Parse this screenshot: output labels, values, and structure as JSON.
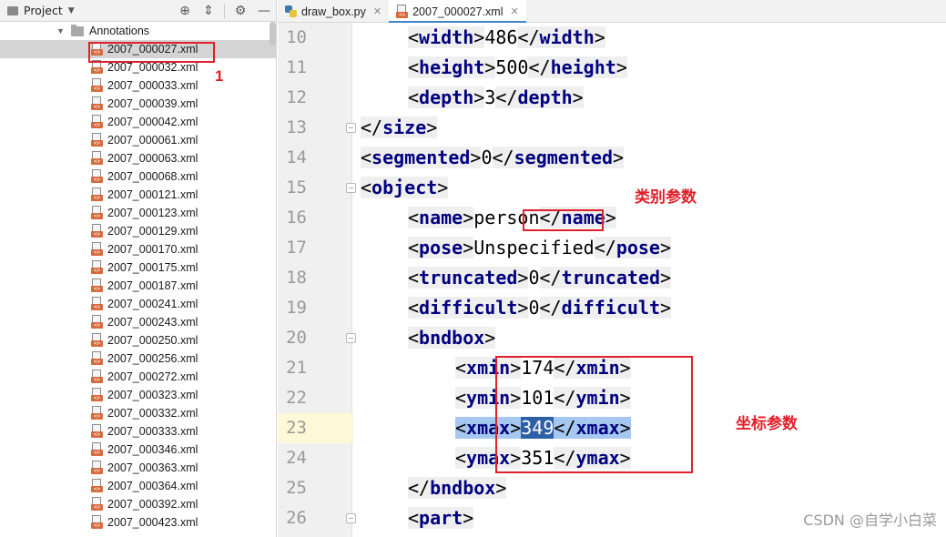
{
  "project_panel": {
    "title": "Project",
    "folder": "Annotations",
    "files": [
      "2007_000027.xml",
      "2007_000032.xml",
      "2007_000033.xml",
      "2007_000039.xml",
      "2007_000042.xml",
      "2007_000061.xml",
      "2007_000063.xml",
      "2007_000068.xml",
      "2007_000121.xml",
      "2007_000123.xml",
      "2007_000129.xml",
      "2007_000170.xml",
      "2007_000175.xml",
      "2007_000187.xml",
      "2007_000241.xml",
      "2007_000243.xml",
      "2007_000250.xml",
      "2007_000256.xml",
      "2007_000272.xml",
      "2007_000323.xml",
      "2007_000332.xml",
      "2007_000333.xml",
      "2007_000346.xml",
      "2007_000363.xml",
      "2007_000364.xml",
      "2007_000392.xml",
      "2007_000423.xml"
    ],
    "selected_index": 0,
    "annotation_number": "1"
  },
  "tabs": [
    {
      "label": "draw_box.py",
      "active": false
    },
    {
      "label": "2007_000027.xml",
      "active": true
    }
  ],
  "code": {
    "lines": [
      {
        "n": "10",
        "indent": 2,
        "parts": [
          [
            "b",
            "<"
          ],
          [
            "t",
            "width"
          ],
          [
            "b",
            ">"
          ],
          [
            "x",
            "486"
          ],
          [
            "b",
            "</"
          ],
          [
            "t",
            "width"
          ],
          [
            "b",
            ">"
          ]
        ]
      },
      {
        "n": "11",
        "indent": 2,
        "parts": [
          [
            "b",
            "<"
          ],
          [
            "t",
            "height"
          ],
          [
            "b",
            ">"
          ],
          [
            "x",
            "500"
          ],
          [
            "b",
            "</"
          ],
          [
            "t",
            "height"
          ],
          [
            "b",
            ">"
          ]
        ]
      },
      {
        "n": "12",
        "indent": 2,
        "parts": [
          [
            "b",
            "<"
          ],
          [
            "t",
            "depth"
          ],
          [
            "b",
            ">"
          ],
          [
            "x",
            "3"
          ],
          [
            "b",
            "</"
          ],
          [
            "t",
            "depth"
          ],
          [
            "b",
            ">"
          ]
        ]
      },
      {
        "n": "13",
        "indent": 1,
        "parts": [
          [
            "b",
            "</"
          ],
          [
            "t",
            "size"
          ],
          [
            "b",
            ">"
          ]
        ]
      },
      {
        "n": "14",
        "indent": 1,
        "parts": [
          [
            "b",
            "<"
          ],
          [
            "t",
            "segmented"
          ],
          [
            "b",
            ">"
          ],
          [
            "x",
            "0"
          ],
          [
            "b",
            "</"
          ],
          [
            "t",
            "segmented"
          ],
          [
            "b",
            ">"
          ]
        ]
      },
      {
        "n": "15",
        "indent": 1,
        "parts": [
          [
            "b",
            "<"
          ],
          [
            "t",
            "object"
          ],
          [
            "b",
            ">"
          ]
        ]
      },
      {
        "n": "16",
        "indent": 2,
        "parts": [
          [
            "b",
            "<"
          ],
          [
            "t",
            "name"
          ],
          [
            "b",
            ">"
          ],
          [
            "x",
            "person"
          ],
          [
            "b",
            "</"
          ],
          [
            "t",
            "name"
          ],
          [
            "b",
            ">"
          ]
        ]
      },
      {
        "n": "17",
        "indent": 2,
        "parts": [
          [
            "b",
            "<"
          ],
          [
            "t",
            "pose"
          ],
          [
            "b",
            ">"
          ],
          [
            "x",
            "Unspecified"
          ],
          [
            "b",
            "</"
          ],
          [
            "t",
            "pose"
          ],
          [
            "b",
            ">"
          ]
        ]
      },
      {
        "n": "18",
        "indent": 2,
        "parts": [
          [
            "b",
            "<"
          ],
          [
            "t",
            "truncated"
          ],
          [
            "b",
            ">"
          ],
          [
            "x",
            "0"
          ],
          [
            "b",
            "</"
          ],
          [
            "t",
            "truncated"
          ],
          [
            "b",
            ">"
          ]
        ]
      },
      {
        "n": "19",
        "indent": 2,
        "parts": [
          [
            "b",
            "<"
          ],
          [
            "t",
            "difficult"
          ],
          [
            "b",
            ">"
          ],
          [
            "x",
            "0"
          ],
          [
            "b",
            "</"
          ],
          [
            "t",
            "difficult"
          ],
          [
            "b",
            ">"
          ]
        ]
      },
      {
        "n": "20",
        "indent": 2,
        "parts": [
          [
            "b",
            "<"
          ],
          [
            "t",
            "bndbox"
          ],
          [
            "b",
            ">"
          ]
        ]
      },
      {
        "n": "21",
        "indent": 3,
        "parts": [
          [
            "b",
            "<"
          ],
          [
            "t",
            "xmin"
          ],
          [
            "b",
            ">"
          ],
          [
            "x",
            "174"
          ],
          [
            "b",
            "</"
          ],
          [
            "t",
            "xmin"
          ],
          [
            "b",
            ">"
          ]
        ]
      },
      {
        "n": "22",
        "indent": 3,
        "parts": [
          [
            "b",
            "<"
          ],
          [
            "t",
            "ymin"
          ],
          [
            "b",
            ">"
          ],
          [
            "x",
            "101"
          ],
          [
            "b",
            "</"
          ],
          [
            "t",
            "ymin"
          ],
          [
            "b",
            ">"
          ]
        ]
      },
      {
        "n": "23",
        "indent": 3,
        "parts": [
          [
            "b",
            "<"
          ],
          [
            "t",
            "xmax"
          ],
          [
            "b",
            ">"
          ],
          [
            "x",
            "349"
          ],
          [
            "b",
            "</"
          ],
          [
            "t",
            "xmax"
          ],
          [
            "b",
            ">"
          ]
        ]
      },
      {
        "n": "24",
        "indent": 3,
        "parts": [
          [
            "b",
            "<"
          ],
          [
            "t",
            "ymax"
          ],
          [
            "b",
            ">"
          ],
          [
            "x",
            "351"
          ],
          [
            "b",
            "</"
          ],
          [
            "t",
            "ymax"
          ],
          [
            "b",
            ">"
          ]
        ]
      },
      {
        "n": "25",
        "indent": 2,
        "parts": [
          [
            "b",
            "</"
          ],
          [
            "t",
            "bndbox"
          ],
          [
            "b",
            ">"
          ]
        ]
      },
      {
        "n": "26",
        "indent": 2,
        "parts": [
          [
            "b",
            "<"
          ],
          [
            "t",
            "part"
          ],
          [
            "b",
            ">"
          ]
        ]
      }
    ],
    "current_line": "23"
  },
  "annotations": {
    "category_label": "类别参数",
    "coords_label": "坐标参数"
  },
  "watermark": "CSDN @自学小白菜",
  "colors": {
    "accent_red": "#e0202a",
    "tag_blue": "#000080",
    "selection": "#a6c8f0",
    "current_line": "#fcf8d8"
  }
}
